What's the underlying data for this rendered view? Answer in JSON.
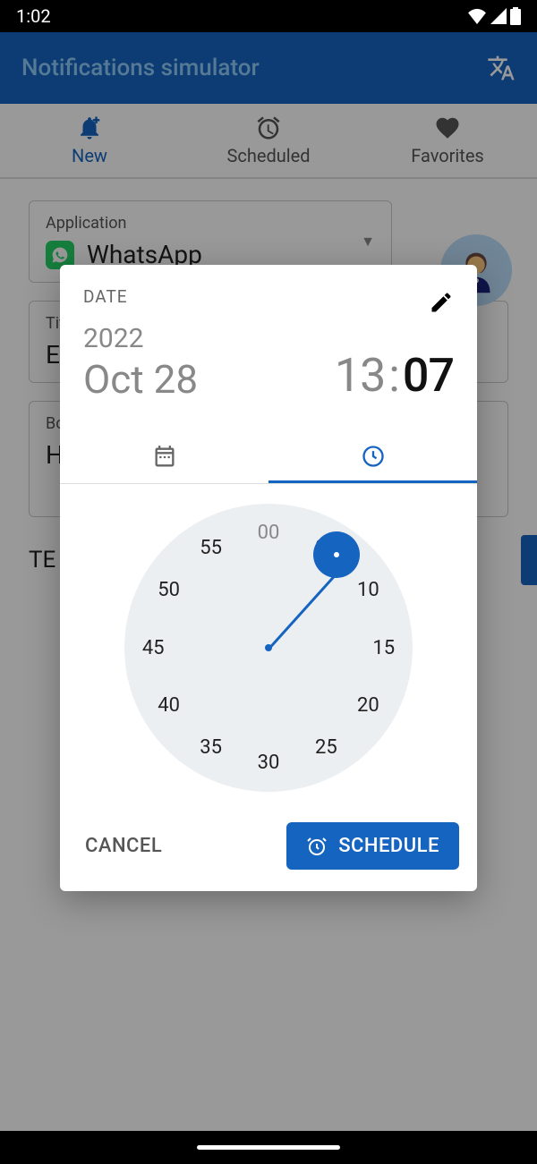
{
  "status": {
    "time": "1:02"
  },
  "header": {
    "title": "Notifications simulator"
  },
  "tabs": {
    "items": [
      {
        "label": "New"
      },
      {
        "label": "Scheduled"
      },
      {
        "label": "Favorites"
      }
    ]
  },
  "form": {
    "application_label": "Application",
    "application_value": "WhatsApp",
    "title_label": "Tit",
    "title_value": "E",
    "body_label": "Bo",
    "body_value": "H",
    "test_label": "TE"
  },
  "dialog": {
    "date_label": "DATE",
    "year": "2022",
    "monthday": "Oct 28",
    "hour": "13",
    "minute": "07",
    "cancel": "CANCEL",
    "schedule": "SCHEDULE",
    "clock_numbers": [
      "00",
      "05",
      "10",
      "15",
      "20",
      "25",
      "30",
      "35",
      "40",
      "45",
      "50",
      "55"
    ]
  }
}
